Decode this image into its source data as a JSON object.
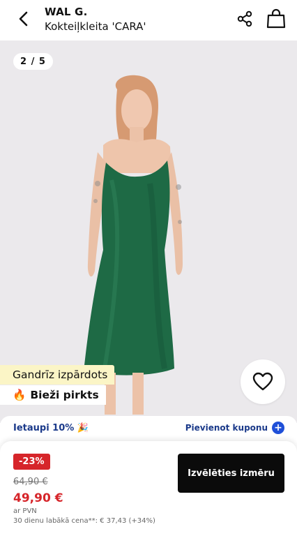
{
  "header": {
    "brand": "WAL G.",
    "product_name": "Kokteiļkleita 'CARA'"
  },
  "gallery": {
    "counter": "2 / 5",
    "tag_low_stock": "Gandrīz izpārdots",
    "tag_popular": "Bieži pirkts",
    "dress_color": "#1e6a45"
  },
  "coupon": {
    "save_text": "Ietaupi 10% 🎉",
    "add_coupon_label": "Pievienot kuponu"
  },
  "pricing": {
    "discount_badge": "-23%",
    "old_price": "64,90 €",
    "price": "49,90 €",
    "vat_note": "ar PVN",
    "history_note": "30 dienu labākā cena**: € 37,43 (+34%)"
  },
  "cta": {
    "select_size_label": "Izvēlēties izmēru"
  },
  "colors": {
    "sale_red": "#d6252a",
    "accent_blue": "#1f4fd8",
    "low_stock_bg": "#fbf5c6"
  }
}
